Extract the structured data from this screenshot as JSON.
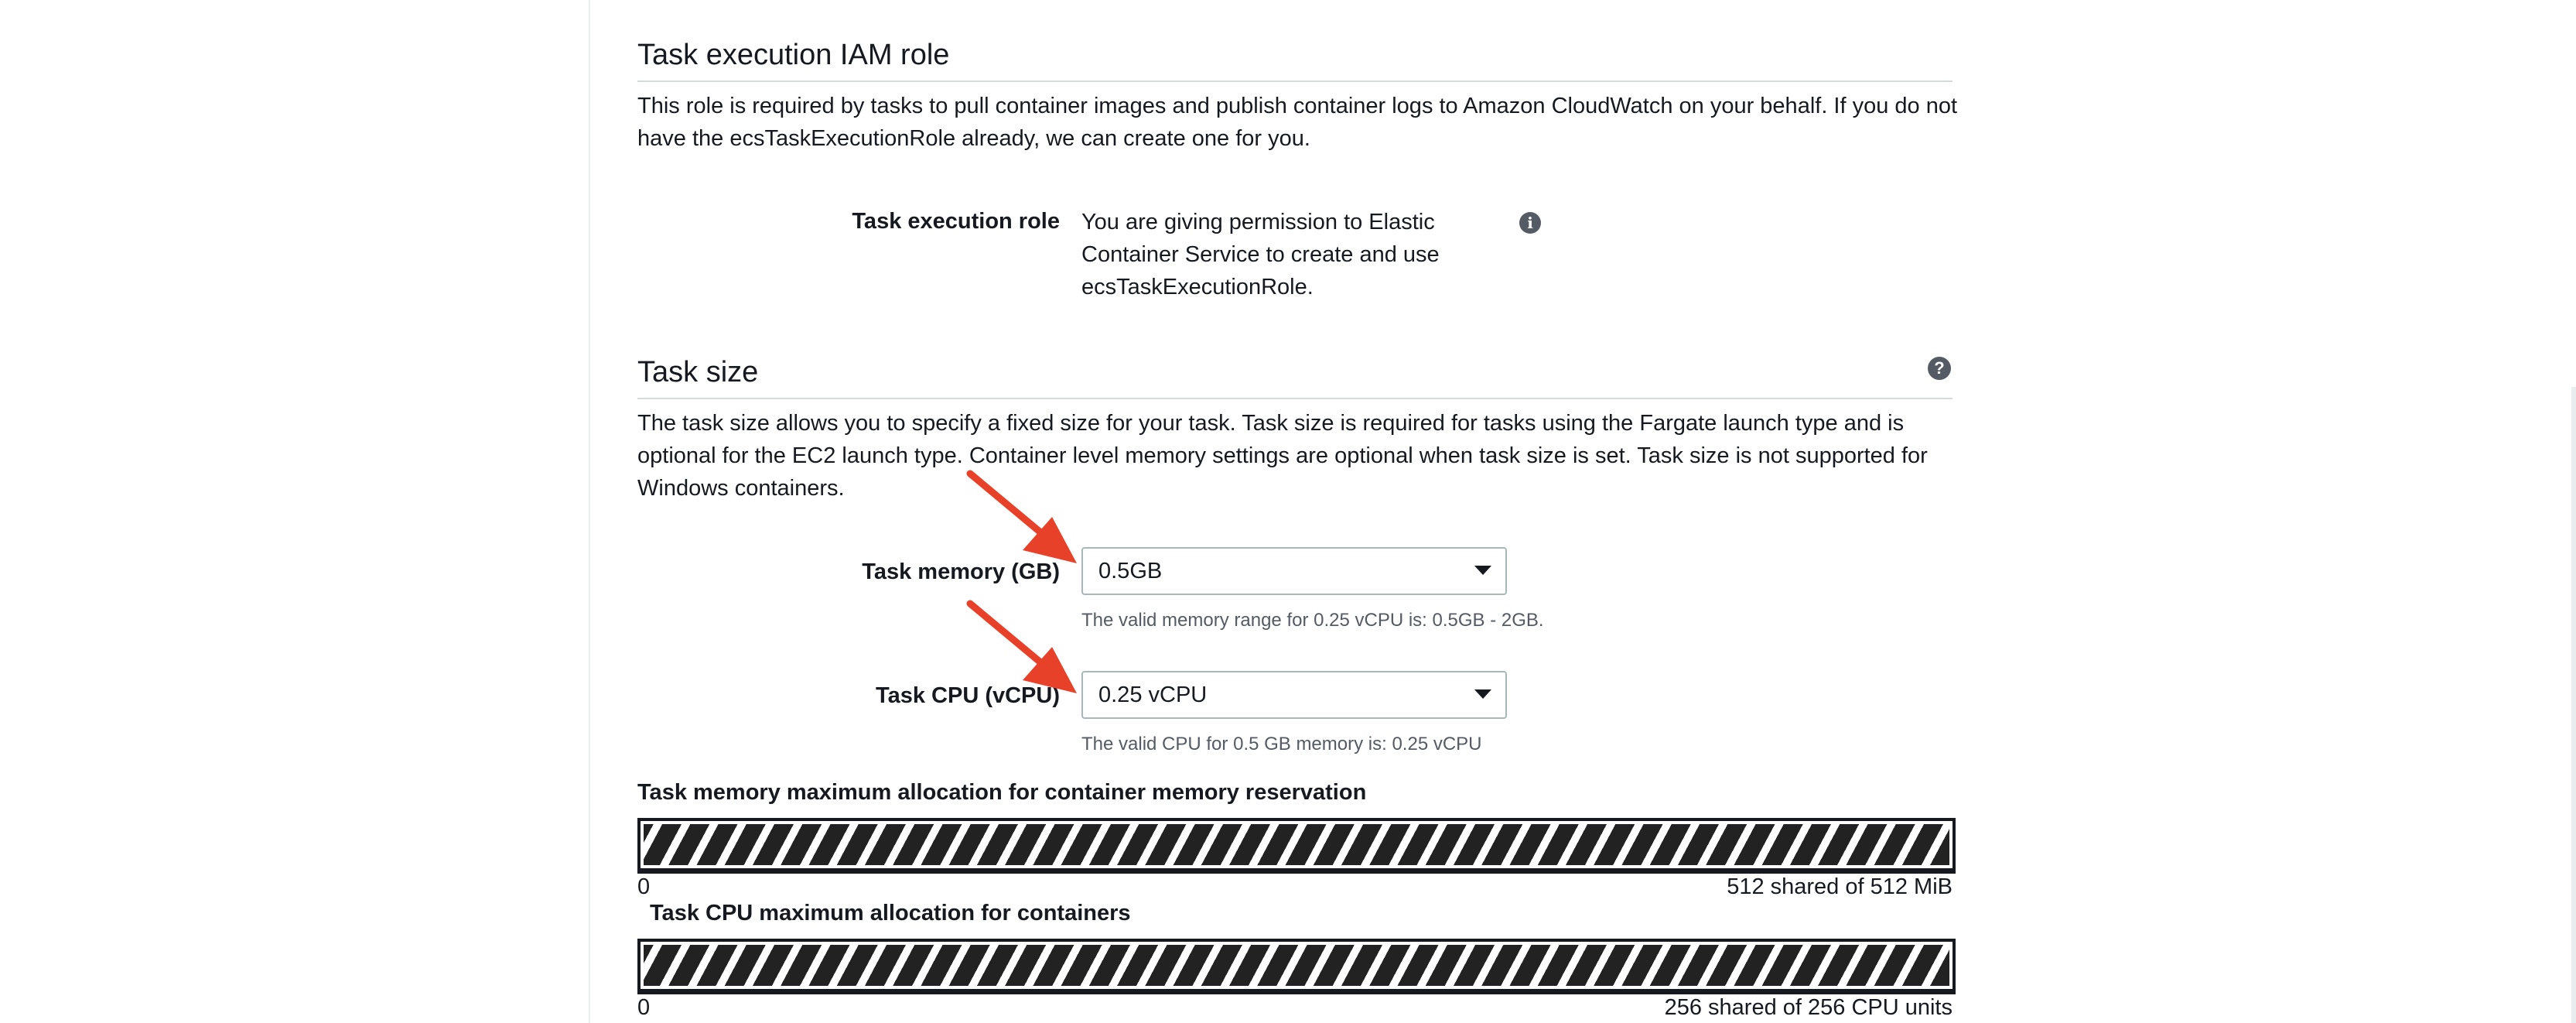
{
  "execution_role_section": {
    "title": "Task execution IAM role",
    "description": "This role is required by tasks to pull container images and publish container logs to Amazon CloudWatch on your behalf. If you do not have the ecsTaskExecutionRole already, we can create one for you.",
    "field_label": "Task execution role",
    "field_value": "You are giving permission to Elastic Container Service to create and use ecsTaskExecutionRole.",
    "info_icon": "info-icon"
  },
  "task_size_section": {
    "title": "Task size",
    "help_icon": "help-icon",
    "description": "The task size allows you to specify a fixed size for your task. Task size is required for tasks using the Fargate launch type and is optional for the EC2 launch type. Container level memory settings are optional when task size is set. Task size is not supported for Windows containers.",
    "memory": {
      "label": "Task memory (GB)",
      "value": "0.5GB",
      "hint": "The valid memory range for 0.25 vCPU is: 0.5GB - 2GB."
    },
    "cpu": {
      "label": "Task CPU (vCPU)",
      "value": "0.25 vCPU",
      "hint": "The valid CPU for 0.5 GB memory is: 0.25 vCPU"
    }
  },
  "allocation": {
    "memory": {
      "label": "Task memory maximum allocation for container memory reservation",
      "min_label": "0",
      "max_label": "512 shared of 512 MiB",
      "fill_fraction": 1.0
    },
    "cpu": {
      "label": "Task CPU maximum allocation for containers",
      "min_label": "0",
      "max_label": "256 shared of 256 CPU units",
      "fill_fraction": 1.0
    }
  },
  "colors": {
    "annotation_arrow": "#e8412a",
    "label_text": "#16191f",
    "hint_text": "#545b64",
    "input_border": "#aab7b8",
    "divider": "#d5dbdb"
  }
}
